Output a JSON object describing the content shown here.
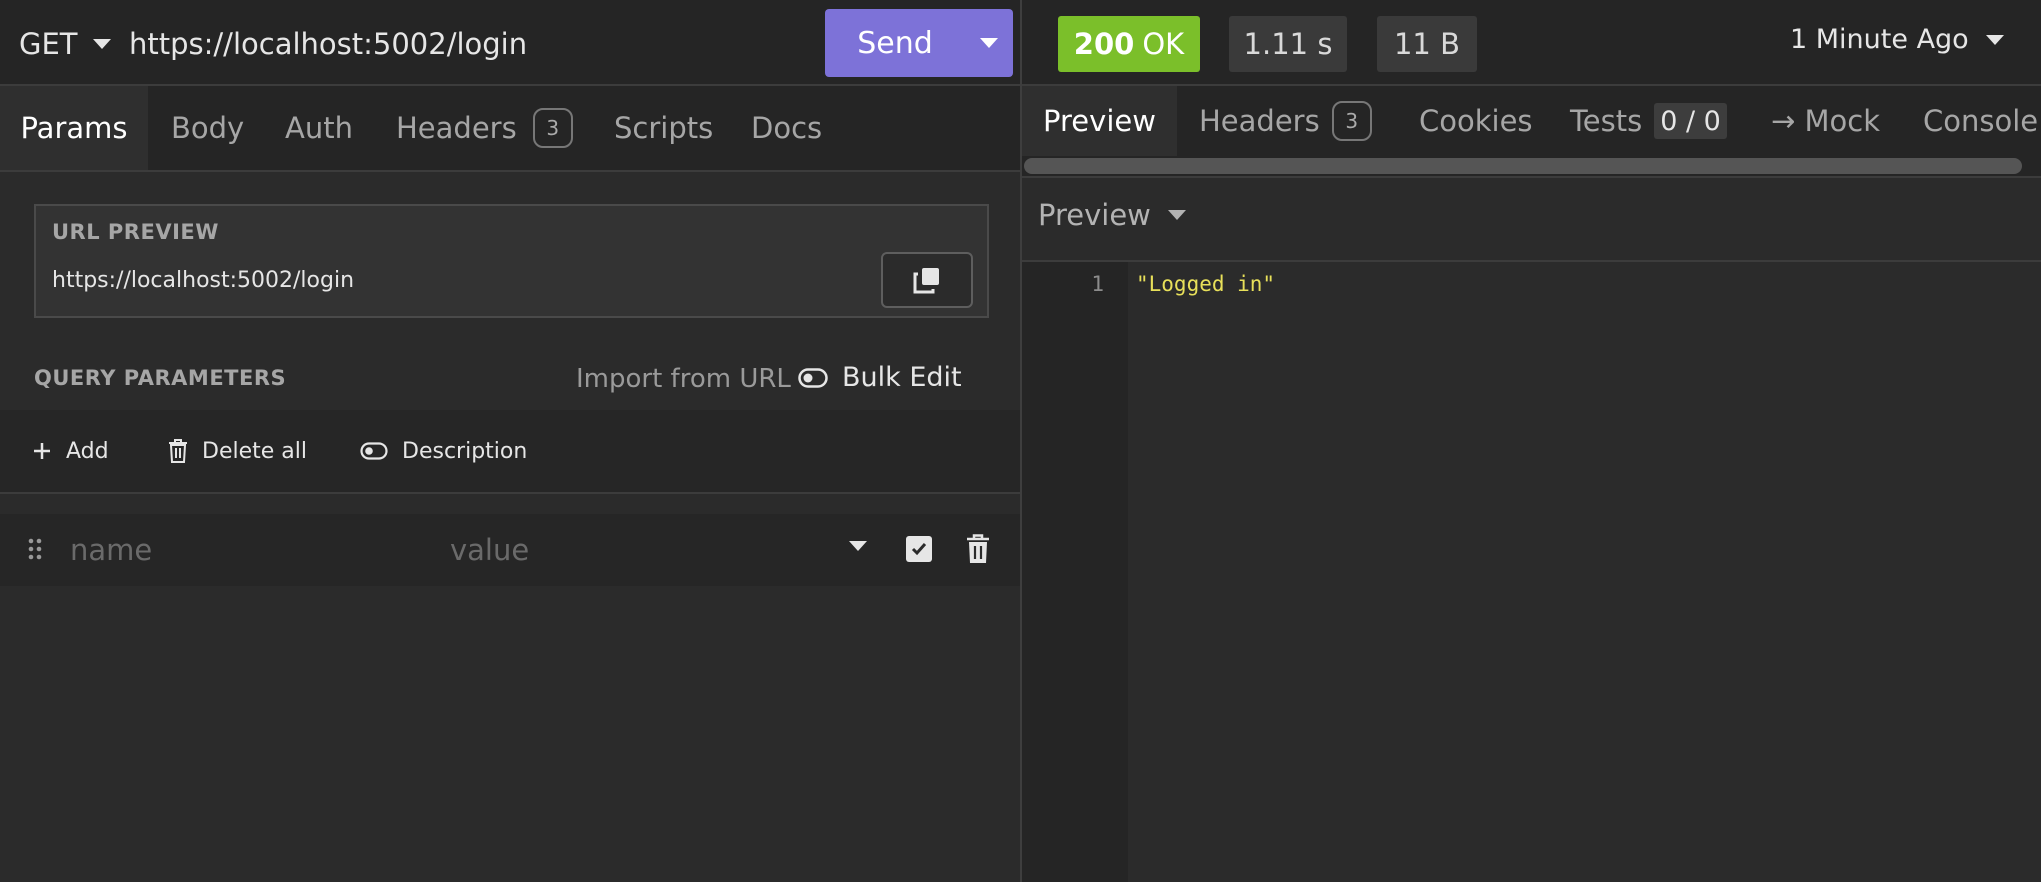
{
  "request": {
    "method": "GET",
    "url": "https://localhost:5002/login",
    "send_label": "Send"
  },
  "request_tabs": {
    "params": "Params",
    "body": "Body",
    "auth": "Auth",
    "headers": "Headers",
    "headers_count": "3",
    "scripts": "Scripts",
    "docs": "Docs"
  },
  "url_preview": {
    "title": "URL PREVIEW",
    "url": "https://localhost:5002/login"
  },
  "query_params": {
    "title": "QUERY PARAMETERS",
    "import_label": "Import from URL",
    "bulk_edit_label": "Bulk Edit",
    "add_label": "Add",
    "delete_all_label": "Delete all",
    "description_label": "Description",
    "row": {
      "name_placeholder": "name",
      "value_placeholder": "value"
    }
  },
  "response": {
    "status_code": "200",
    "status_text": "OK",
    "status_color": "#7bbf2a",
    "time": "1.11 s",
    "size": "11 B",
    "timestamp": "1 Minute Ago"
  },
  "response_tabs": {
    "preview": "Preview",
    "headers": "Headers",
    "headers_count": "3",
    "cookies": "Cookies",
    "tests": "Tests",
    "tests_count": "0 / 0",
    "mock": "→ Mock",
    "console": "Console"
  },
  "preview": {
    "mode_label": "Preview",
    "line_number": "1",
    "body_line": "\"Logged in\""
  },
  "colors": {
    "accent": "#7d72d8",
    "success": "#7bbf2a",
    "string": "#e8e05a",
    "background": "#2b2b2b"
  }
}
